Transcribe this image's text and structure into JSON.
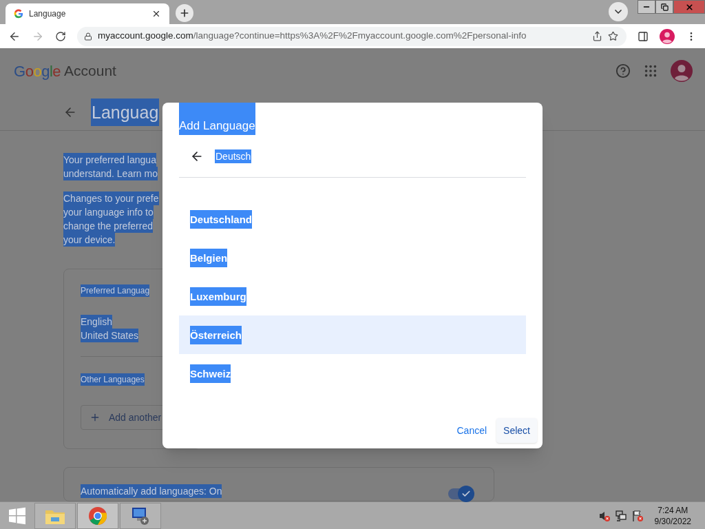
{
  "browser": {
    "tab": {
      "title": "Language"
    },
    "url": {
      "host": "myaccount.google.com",
      "path": "/language?continue=https%3A%2F%2Fmyaccount.google.com%2Fpersonal-info"
    }
  },
  "header": {
    "logo": "Google",
    "product": "Account"
  },
  "page": {
    "title": "Languag",
    "intro_lines": [
      "Your preferred langua",
      "understand. Learn mo"
    ],
    "note_lines": [
      "Changes to your prefe",
      "your language info to",
      "change the preferred",
      "your device."
    ],
    "preferred_card": {
      "heading": "Preferred Languag",
      "language": "English",
      "region": "United States",
      "other_heading": "Other Languages",
      "add_button": "Add another"
    },
    "auto_card": {
      "label": "Automatically add languages: On",
      "on": true
    }
  },
  "dialog": {
    "title": "Add Language",
    "language": "Deutsch",
    "options": [
      {
        "label": "Deutschland",
        "selected": false
      },
      {
        "label": "Belgien",
        "selected": false
      },
      {
        "label": "Luxemburg",
        "selected": false
      },
      {
        "label": "Österreich",
        "selected": true
      },
      {
        "label": "Schweiz",
        "selected": false
      }
    ],
    "buttons": [
      {
        "label": "Cancel",
        "kind": "text"
      },
      {
        "label": "Select",
        "kind": "tonal"
      }
    ]
  },
  "taskbar": {
    "time": "7:24 AM",
    "date": "9/30/2022"
  }
}
